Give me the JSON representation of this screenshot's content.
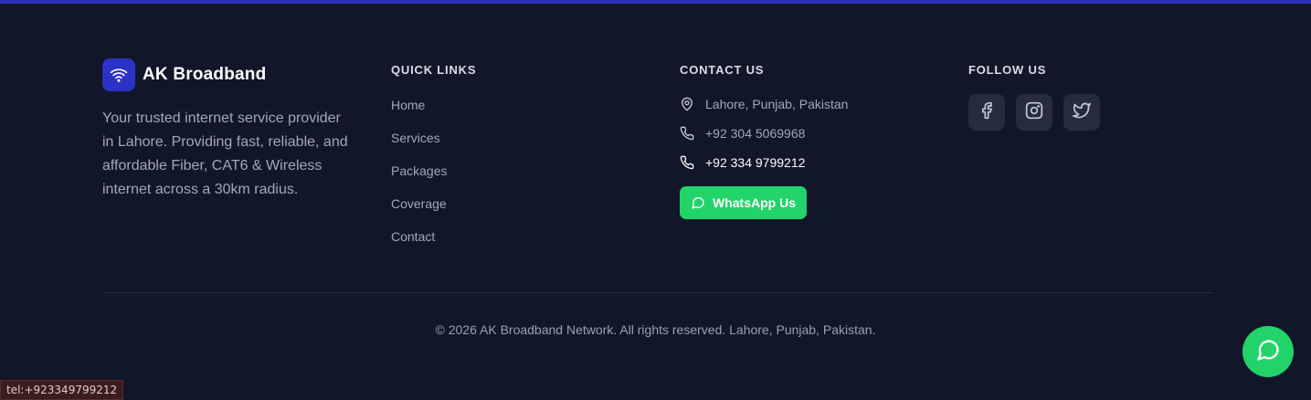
{
  "brand": {
    "name": "AK Broadband",
    "description": "Your trusted internet service provider in Lahore. Providing fast, reliable, and affordable Fiber, CAT6 & Wireless internet across a 30km radius.",
    "logo_icon": "wifi-icon"
  },
  "quick_links": {
    "title": "QUICK LINKS",
    "items": [
      {
        "label": "Home"
      },
      {
        "label": "Services"
      },
      {
        "label": "Packages"
      },
      {
        "label": "Coverage"
      },
      {
        "label": "Contact"
      }
    ]
  },
  "contact": {
    "title": "CONTACT US",
    "address": {
      "text": "Lahore, Punjab, Pakistan",
      "icon": "map-pin-icon"
    },
    "phone1": {
      "text": "+92 304 5069968",
      "icon": "phone-icon"
    },
    "phone2": {
      "text": "+92 334 9799212",
      "icon": "phone-icon"
    },
    "whatsapp_label": "WhatsApp Us"
  },
  "follow": {
    "title": "FOLLOW US",
    "socials": [
      "facebook-icon",
      "instagram-icon",
      "twitter-icon"
    ]
  },
  "footer": {
    "copyright": "© 2026 AK Broadband Network. All rights reserved. Lahore, Punjab, Pakistan."
  },
  "status_bar": {
    "url": "tel:+923349799212"
  },
  "colors": {
    "background": "#111628",
    "accent": "#2b32c6",
    "whatsapp": "#22d36a",
    "social_bg": "#262c3e"
  }
}
